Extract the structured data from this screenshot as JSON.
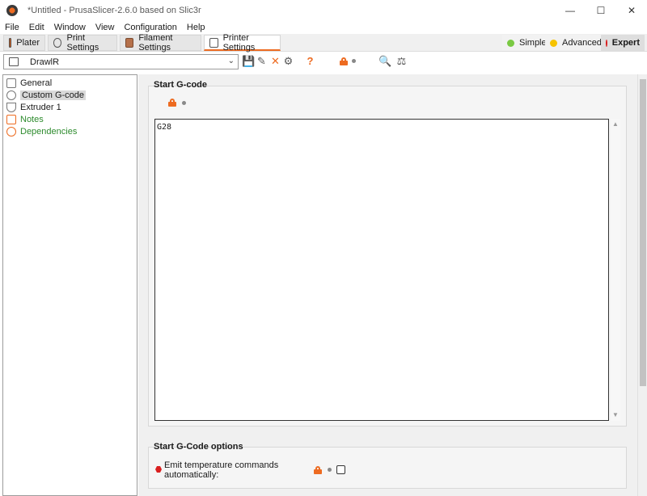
{
  "window": {
    "title": "*Untitled - PrusaSlicer-2.6.0 based on Slic3r",
    "controls": [
      "—",
      "☐",
      "✕"
    ]
  },
  "menu": [
    "File",
    "Edit",
    "Window",
    "View",
    "Configuration",
    "Help"
  ],
  "tabs": [
    {
      "label": "Plater",
      "active": false
    },
    {
      "label": "Print Settings",
      "active": false
    },
    {
      "label": "Filament Settings",
      "active": false
    },
    {
      "label": "Printer Settings",
      "active": true
    }
  ],
  "modes": [
    {
      "label": "Simple",
      "color": "#7ac943",
      "active": false
    },
    {
      "label": "Advanced",
      "color": "#f6c300",
      "active": false
    },
    {
      "label": "Expert",
      "color": "#d91f1f",
      "active": true
    }
  ],
  "preset": {
    "name": "DrawlR"
  },
  "tree": [
    {
      "label": "General",
      "selected": false,
      "green": false,
      "icon": "printer-icon"
    },
    {
      "label": "Custom G-code",
      "selected": true,
      "green": false,
      "icon": "gear-icon"
    },
    {
      "label": "Extruder 1",
      "selected": false,
      "green": false,
      "icon": "extruder-icon"
    },
    {
      "label": "Notes",
      "selected": false,
      "green": true,
      "icon": "notes-icon"
    },
    {
      "label": "Dependencies",
      "selected": false,
      "green": true,
      "icon": "dependencies-icon"
    }
  ],
  "start_gcode": {
    "title": "Start G-code",
    "value": "G28"
  },
  "start_gcode_options": {
    "title": "Start G-Code options",
    "emit_label_line1": "Emit temperature commands",
    "emit_label_line2": "automatically:",
    "checked": false
  },
  "colors": {
    "accent": "#ed6b21",
    "green_text": "#2d8b2d"
  }
}
